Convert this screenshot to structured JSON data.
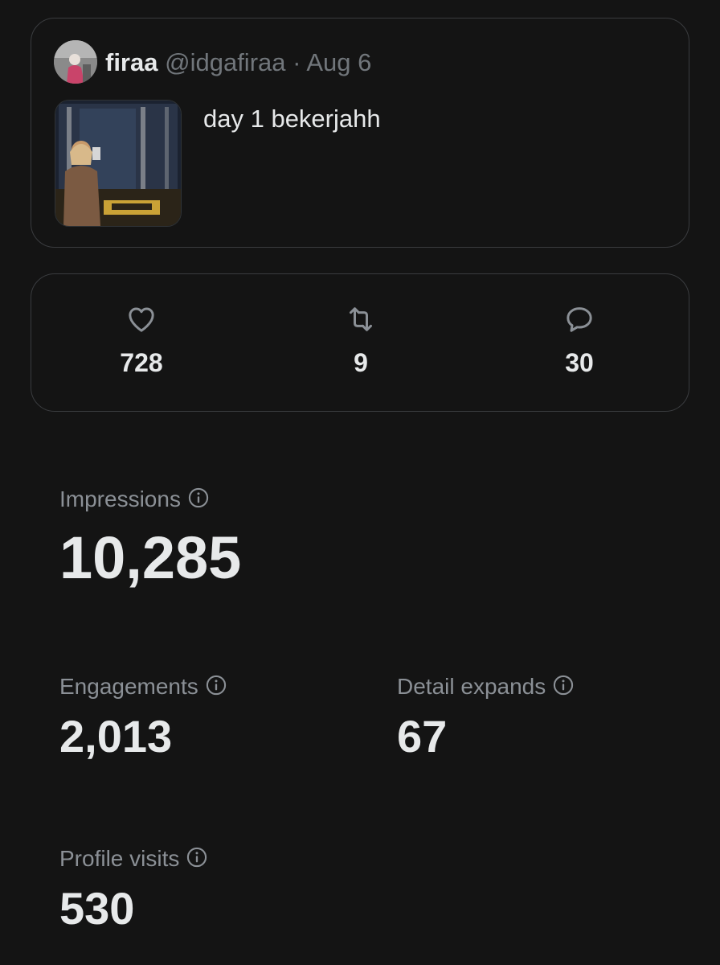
{
  "post": {
    "display_name": "firaa",
    "handle": "@idgafiraa",
    "separator": "·",
    "date": "Aug 6",
    "text": "day 1 bekerjahh"
  },
  "engagement_counts": {
    "likes": "728",
    "reposts": "9",
    "replies": "30"
  },
  "metrics": {
    "impressions": {
      "label": "Impressions",
      "value": "10,285"
    },
    "engagements": {
      "label": "Engagements",
      "value": "2,013"
    },
    "detail_expands": {
      "label": "Detail expands",
      "value": "67"
    },
    "profile_visits": {
      "label": "Profile visits",
      "value": "530"
    }
  },
  "icons": {
    "like": "heart-icon",
    "repost": "repost-icon",
    "reply": "reply-icon",
    "info": "info-icon"
  },
  "colors": {
    "background": "#141414",
    "border": "#3a3c3f",
    "text_primary": "#e7e9ea",
    "text_secondary": "#71767b",
    "label": "#8b9096"
  }
}
